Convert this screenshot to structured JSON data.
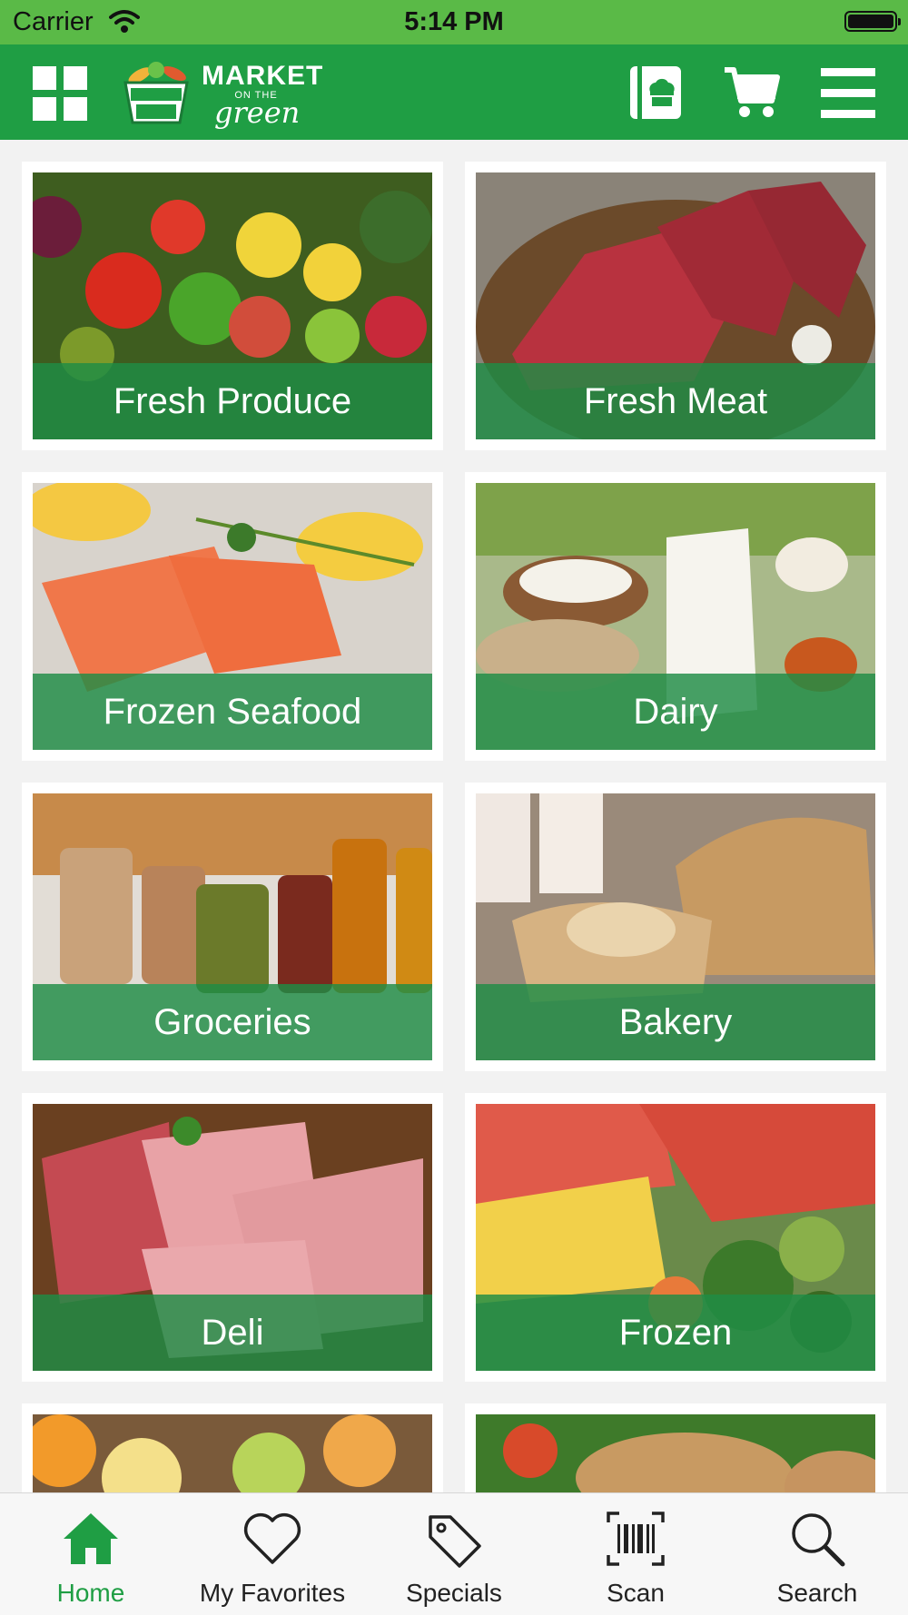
{
  "status_bar": {
    "carrier": "Carrier",
    "time": "5:14 PM"
  },
  "header": {
    "brand": {
      "line1": "MARKET",
      "line2": "ON THE",
      "line3": "green"
    },
    "icons": [
      "grid-icon",
      "recipe-book-icon",
      "cart-icon",
      "menu-icon"
    ]
  },
  "categories": [
    {
      "label": "Fresh Produce"
    },
    {
      "label": "Fresh Meat"
    },
    {
      "label": "Frozen Seafood"
    },
    {
      "label": "Dairy"
    },
    {
      "label": "Groceries"
    },
    {
      "label": "Bakery"
    },
    {
      "label": "Deli"
    },
    {
      "label": "Frozen"
    }
  ],
  "tabbar": {
    "active": "Home",
    "tabs": [
      {
        "label": "Home",
        "icon": "home-icon"
      },
      {
        "label": "My Favorites",
        "icon": "heart-icon"
      },
      {
        "label": "Specials",
        "icon": "tag-icon"
      },
      {
        "label": "Scan",
        "icon": "barcode-icon"
      },
      {
        "label": "Search",
        "icon": "search-icon"
      }
    ]
  },
  "colors": {
    "brand_green": "#1f9e44",
    "status_green": "#5aba47",
    "band_green": "#1f8c46"
  }
}
